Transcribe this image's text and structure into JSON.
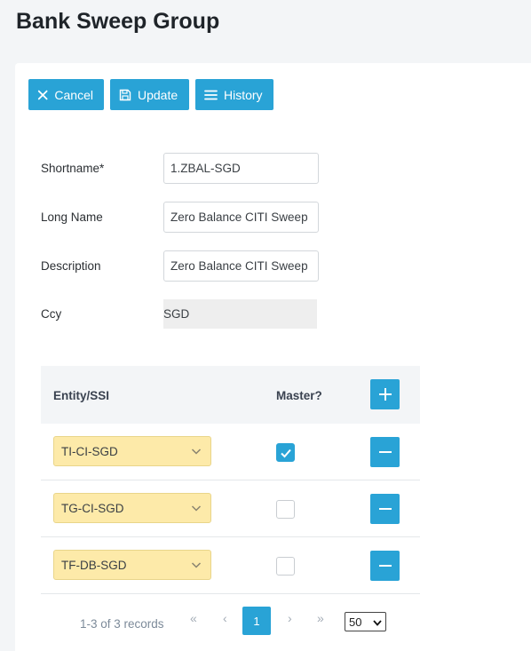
{
  "page": {
    "title": "Bank Sweep Group"
  },
  "toolbar": {
    "cancel_label": "Cancel",
    "update_label": "Update",
    "history_label": "History"
  },
  "form": {
    "shortname": {
      "label": "Shortname*",
      "value": "1.ZBAL-SGD"
    },
    "long_name": {
      "label": "Long Name",
      "value": "Zero Balance CITI Sweep"
    },
    "description": {
      "label": "Description",
      "value": "Zero Balance CITI Sweep"
    },
    "ccy": {
      "label": "Ccy",
      "value": "SGD"
    }
  },
  "grid": {
    "columns": {
      "entity": "Entity/SSI",
      "master": "Master?"
    },
    "rows": [
      {
        "entity": "TI-CI-SGD",
        "master": true
      },
      {
        "entity": "TG-CI-SGD",
        "master": false
      },
      {
        "entity": "TF-DB-SGD",
        "master": false
      }
    ]
  },
  "pager": {
    "records_text": "1-3 of 3 records",
    "first": "«",
    "prev": "‹",
    "current_page": "1",
    "next": "›",
    "last": "»",
    "page_size": "50"
  },
  "colors": {
    "accent": "#29a3d6",
    "select_bg": "#fdeaa9"
  }
}
